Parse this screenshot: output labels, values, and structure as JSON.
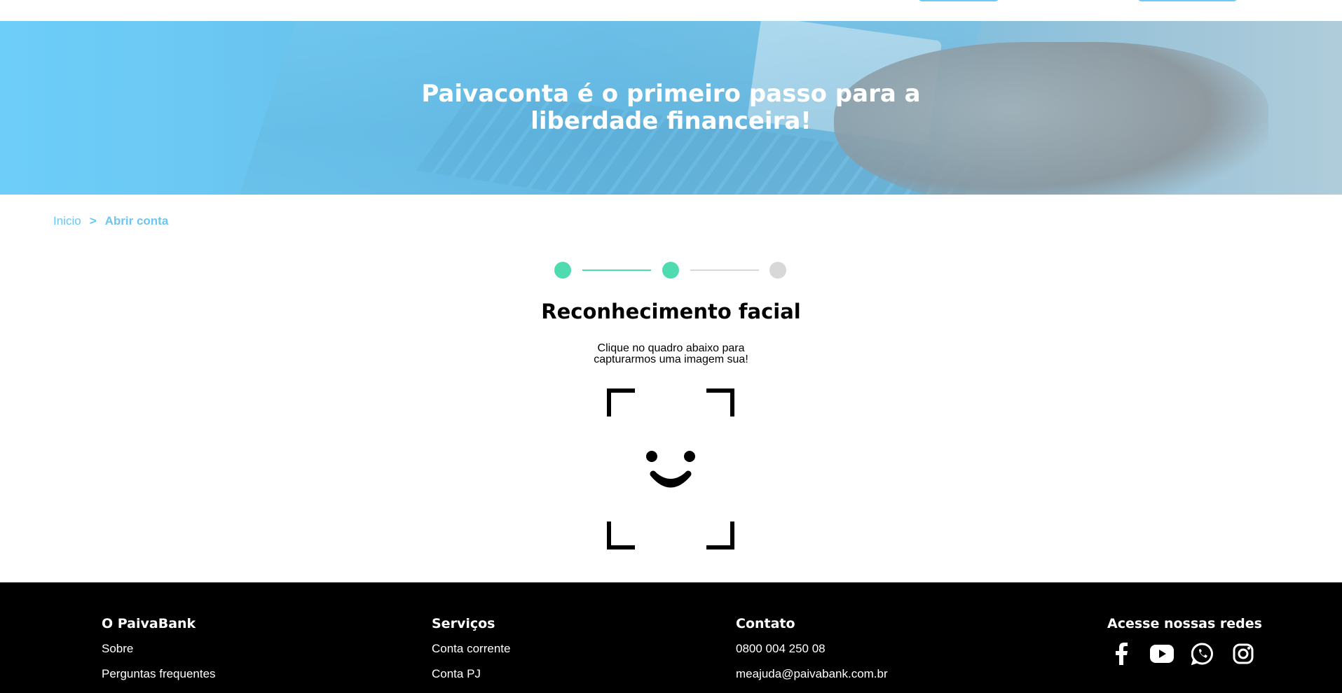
{
  "hero": {
    "title_line1": "Paivaconta é o primeiro passo para a",
    "title_line2": "liberdade financeira!"
  },
  "breadcrumb": {
    "home": "Inicio",
    "separator": ">",
    "current": "Abrir conta"
  },
  "stepper": {
    "total_steps": 3,
    "completed_steps": 2,
    "colors": {
      "done": "#4fdbb0",
      "todo": "#d8d8d8"
    }
  },
  "section": {
    "title": "Reconhecimento facial",
    "instruction_line1": "Clique no quadro abaixo para",
    "instruction_line2": "capturarmos uma imagem sua!",
    "capture_icon": "face-scan-icon"
  },
  "footer": {
    "col1": {
      "title": "O PaivaBank",
      "links": [
        "Sobre",
        "Perguntas frequentes"
      ]
    },
    "col2": {
      "title": "Serviços",
      "links": [
        "Conta corrente",
        "Conta PJ"
      ]
    },
    "col3": {
      "title": "Contato",
      "phone": "0800 004 250 08",
      "email": "meajuda@paivabank.com.br"
    },
    "col4": {
      "title": "Acesse nossas redes",
      "icons": [
        "facebook-icon",
        "youtube-icon",
        "whatsapp-icon",
        "instagram-icon"
      ]
    }
  },
  "colors": {
    "accent": "#6cc6ef",
    "footer_bg": "#000000"
  }
}
